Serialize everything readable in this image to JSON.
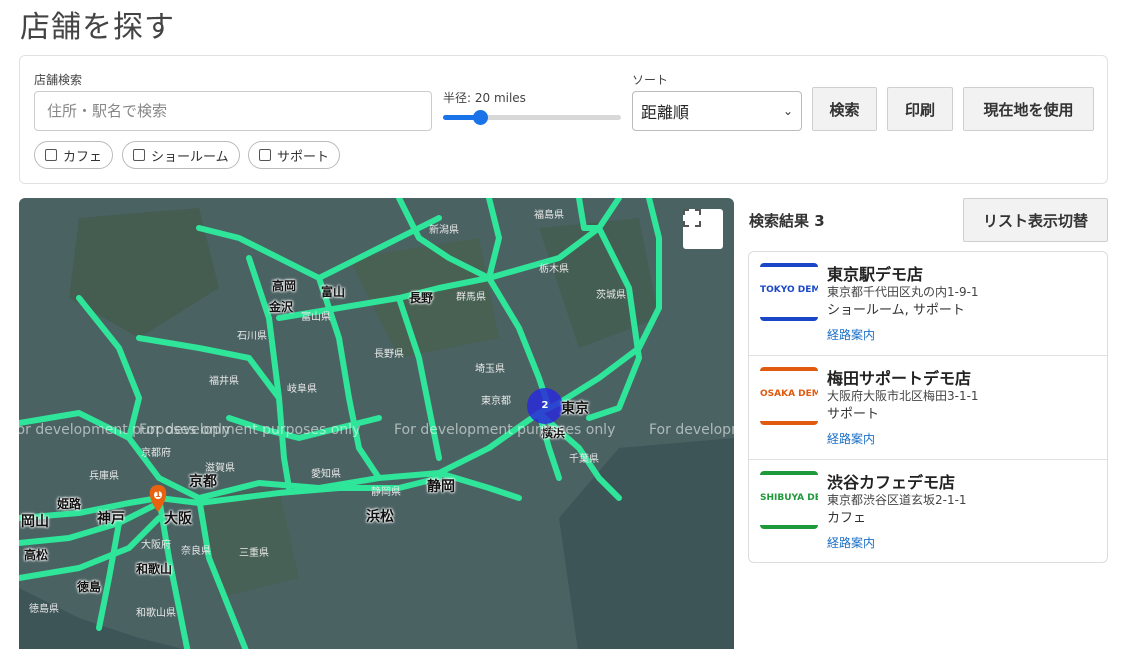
{
  "page": {
    "title": "店舗を探す"
  },
  "search": {
    "label": "店舗検索",
    "placeholder": "住所・駅名で検索",
    "radius_label": "半径: 20 miles",
    "radius_fraction": 0.21,
    "sort_label": "ソート",
    "sort_value": "距離順",
    "buttons": {
      "search": "検索",
      "print": "印刷",
      "locate": "現在地を使用"
    },
    "filters": [
      {
        "label": "カフェ",
        "checked": false
      },
      {
        "label": "ショールーム",
        "checked": false
      },
      {
        "label": "サポート",
        "checked": false
      }
    ]
  },
  "map": {
    "watermark": "For development purposes only",
    "cluster_count": "2",
    "marker_label": "1",
    "prefectures": [
      "福島県",
      "新潟県",
      "栃木県",
      "群馬県",
      "茨城県",
      "石川県",
      "富山県",
      "長野県",
      "埼玉県",
      "福井県",
      "岐阜県",
      "東京都",
      "京都府",
      "滋賀県",
      "愛知県",
      "兵庫県",
      "静岡県",
      "大阪府",
      "奈良県",
      "三重県",
      "和歌山県",
      "徳島県",
      "千葉県"
    ],
    "cities": [
      "高岡",
      "富山",
      "金沢",
      "長野",
      "東京",
      "横浜",
      "京都",
      "静岡",
      "浜松",
      "大阪",
      "神戸",
      "姫路",
      "岡山",
      "高松",
      "和歌山",
      "徳島"
    ]
  },
  "results": {
    "title": "検索結果 3",
    "toggle_label": "リスト表示切替",
    "items": [
      {
        "logo_text": "TOKYO DEMO",
        "logo_color": "#1a47c8",
        "name": "東京駅デモ店",
        "address": "東京都千代田区丸の内1-9-1",
        "categories": "ショールーム, サポート",
        "route_label": "経路案内"
      },
      {
        "logo_text": "OSAKA DEMO",
        "logo_color": "#e05a10",
        "name": "梅田サポートデモ店",
        "address": "大阪府大阪市北区梅田3-1-1",
        "categories": "サポート",
        "route_label": "経路案内"
      },
      {
        "logo_text": "SHIBUYA DEMO",
        "logo_color": "#1f9a3a",
        "name": "渋谷カフェデモ店",
        "address": "東京都渋谷区道玄坂2-1-1",
        "categories": "カフェ",
        "route_label": "経路案内"
      }
    ]
  },
  "colors": {
    "accent": "#1a73e8",
    "road": "#2ee59a",
    "map_land": "#4b6263",
    "link": "#1a6fc4",
    "marker": "#e8620f",
    "cluster": "#2a2ad8"
  },
  "icons": [
    "fullscreen-icon",
    "chevron-down-icon",
    "map-pin-icon"
  ]
}
